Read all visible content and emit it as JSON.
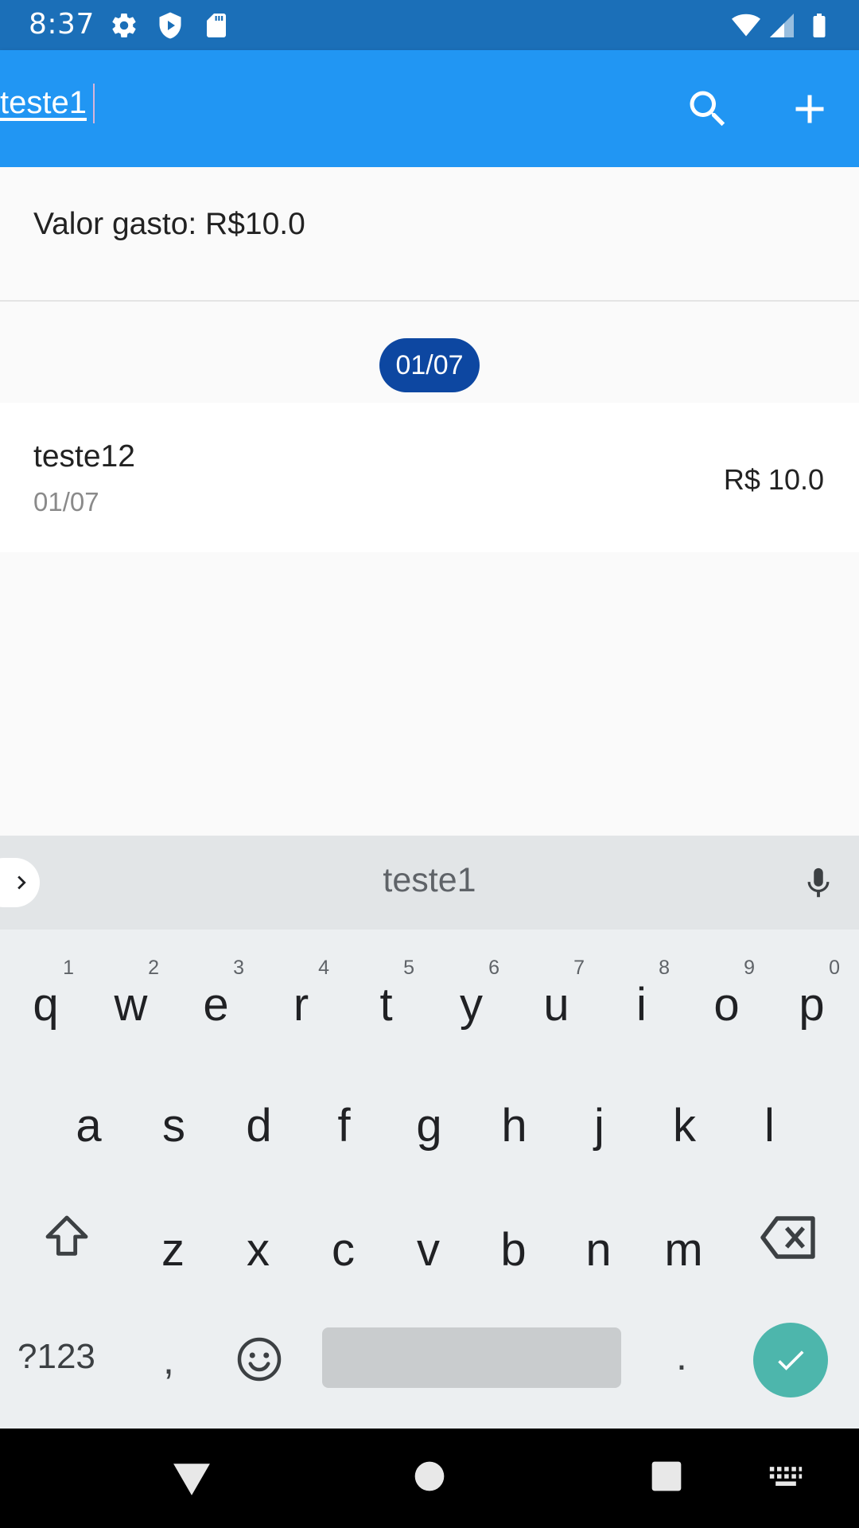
{
  "status_bar": {
    "time": "8:37",
    "left_icons": [
      "gear-icon",
      "shield-play-icon",
      "sd-card-icon"
    ],
    "right_icons": [
      "wifi-icon",
      "signal-icon",
      "battery-icon"
    ]
  },
  "app_bar": {
    "search_value": "teste1",
    "actions": [
      "search-icon",
      "add-icon"
    ],
    "color": "#2196f3"
  },
  "summary": {
    "text": "Valor gasto: R$10.0"
  },
  "list": {
    "section_date": "01/07",
    "items": [
      {
        "title": "teste12",
        "date": "01/07",
        "value": "R$ 10.0"
      }
    ]
  },
  "keyboard": {
    "suggestion": "teste1",
    "row1": [
      {
        "letter": "q",
        "num": "1"
      },
      {
        "letter": "w",
        "num": "2"
      },
      {
        "letter": "e",
        "num": "3"
      },
      {
        "letter": "r",
        "num": "4"
      },
      {
        "letter": "t",
        "num": "5"
      },
      {
        "letter": "y",
        "num": "6"
      },
      {
        "letter": "u",
        "num": "7"
      },
      {
        "letter": "i",
        "num": "8"
      },
      {
        "letter": "o",
        "num": "9"
      },
      {
        "letter": "p",
        "num": "0"
      }
    ],
    "row2": [
      "a",
      "s",
      "d",
      "f",
      "g",
      "h",
      "j",
      "k",
      "l"
    ],
    "row3": [
      "z",
      "x",
      "c",
      "v",
      "b",
      "n",
      "m"
    ],
    "symbols_label": "?123",
    "comma": ",",
    "period": ".",
    "accent_color": "#4db6ac"
  },
  "nav_bar": {
    "buttons": [
      "back-icon",
      "home-icon",
      "recents-icon",
      "keyboard-switch-icon"
    ]
  }
}
